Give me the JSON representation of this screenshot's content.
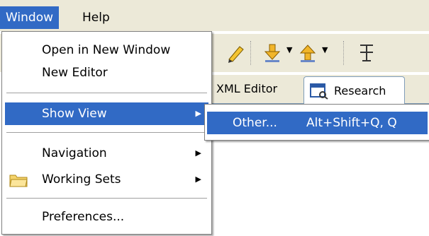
{
  "menubar": {
    "items": [
      {
        "label": "Window"
      },
      {
        "label": "Help"
      }
    ]
  },
  "editor_tabs": {
    "xml_editor": "XML Editor",
    "research": "Research"
  },
  "window_menu": {
    "open_new_window": "Open in New Window",
    "new_editor": "New Editor",
    "show_view": "Show View",
    "navigation": "Navigation",
    "working_sets": "Working Sets",
    "preferences": "Preferences..."
  },
  "show_view_submenu": {
    "other": {
      "label": "Other...",
      "shortcut": "Alt+Shift+Q, Q"
    }
  },
  "icons": {
    "toolbar": [
      "pencil-icon",
      "download-icon",
      "upload-icon",
      "text-icon"
    ],
    "research_tab": "research-window-icon",
    "working_sets": "folder-icon"
  },
  "colors": {
    "highlight": "#316ac5",
    "chrome": "#ece9d8"
  }
}
